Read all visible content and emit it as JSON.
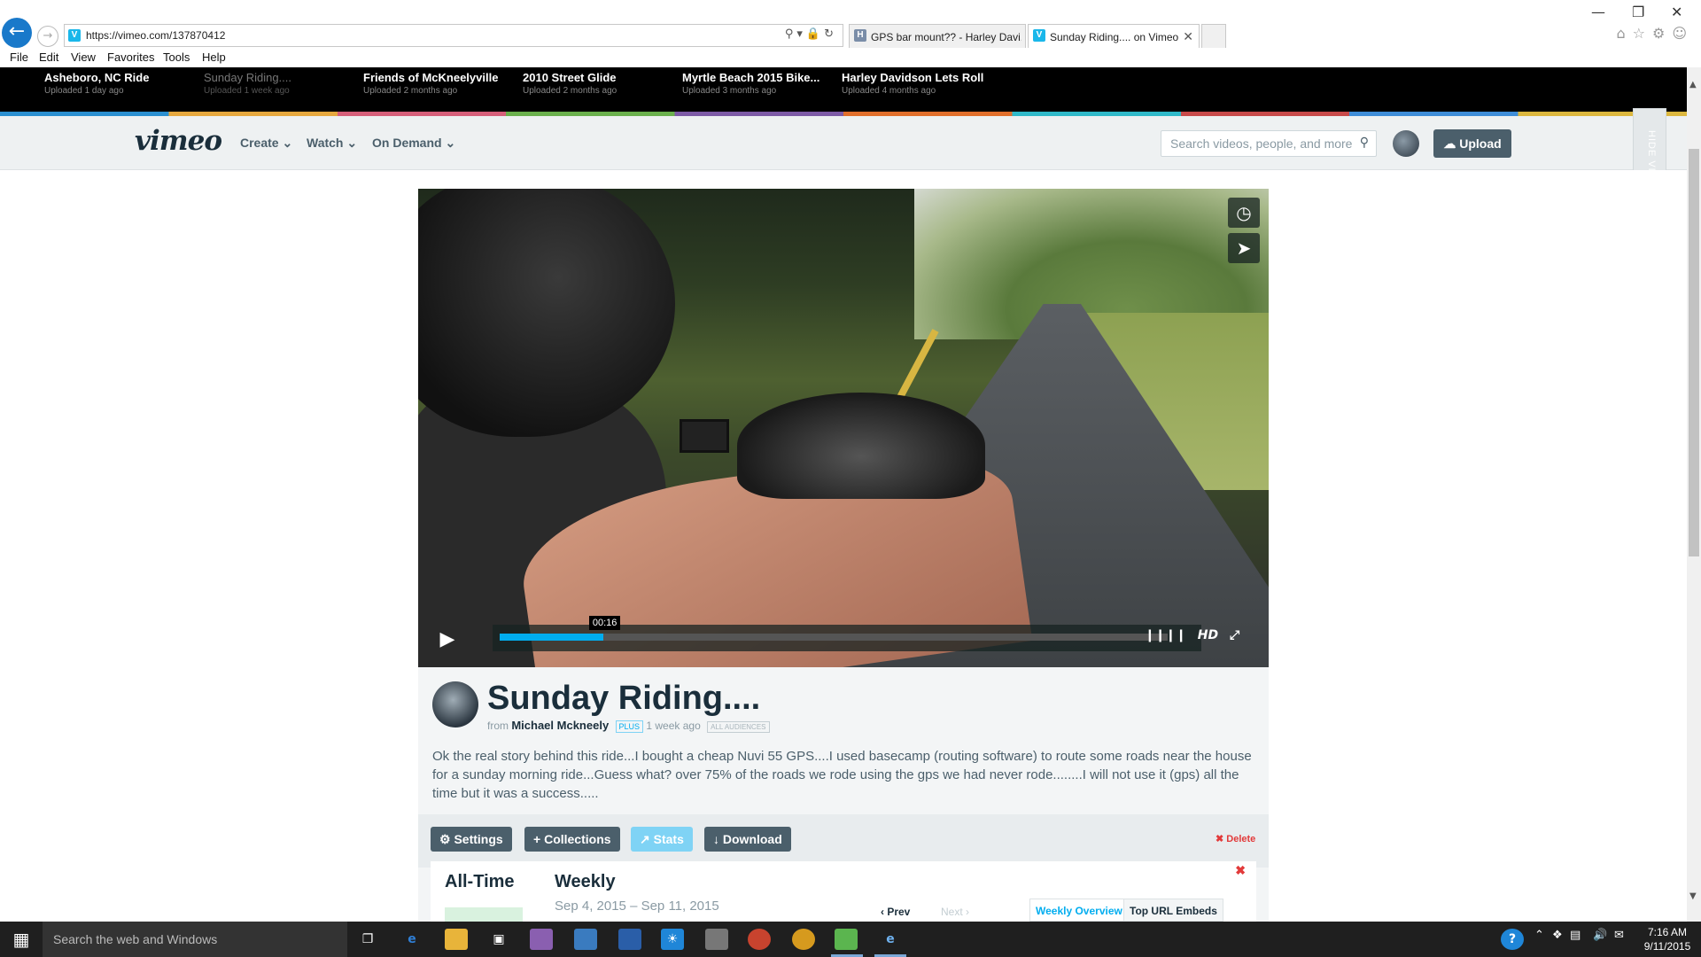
{
  "browser": {
    "url": "https://vimeo.com/137870412",
    "tabs": [
      {
        "title": "GPS bar mount?? - Harley Davi...",
        "active": false
      },
      {
        "title": "Sunday Riding.... on Vimeo",
        "active": true
      }
    ],
    "menu": [
      "File",
      "Edit",
      "View",
      "Favorites",
      "Tools",
      "Help"
    ]
  },
  "recent_videos": [
    {
      "title": "Asheboro, NC Ride",
      "uploaded": "Uploaded 1 day ago",
      "current": false
    },
    {
      "title": "Sunday Riding....",
      "uploaded": "Uploaded 1 week ago",
      "current": true
    },
    {
      "title": "Friends of McKneelyville",
      "uploaded": "Uploaded 2 months ago",
      "current": false
    },
    {
      "title": "2010 Street Glide",
      "uploaded": "Uploaded 2 months ago",
      "current": false
    },
    {
      "title": "Myrtle Beach 2015 Bike...",
      "uploaded": "Uploaded 3 months ago",
      "current": false
    },
    {
      "title": "Harley Davidson Lets Roll",
      "uploaded": "Uploaded 4 months ago",
      "current": false
    }
  ],
  "header": {
    "logo": "vimeo",
    "nav": [
      "Create",
      "Watch",
      "On Demand"
    ],
    "search_placeholder": "Search videos, people, and more",
    "upload_label": "Upload",
    "hide_videos_label": "HIDE VIDEOS"
  },
  "player": {
    "current_time": "00:16",
    "progress_fraction": 0.155,
    "hd_label": "HD"
  },
  "video": {
    "title": "Sunday Riding....",
    "from_label": "from",
    "author": "Michael Mckneely",
    "plus_badge": "PLUS",
    "age": "1 week ago",
    "audience_badge": "ALL AUDIENCES",
    "description": "Ok the real story behind this ride...I bought a cheap Nuvi 55 GPS....I used basecamp (routing software) to route some roads near the house for a sunday morning ride...Guess what? over 75% of the roads we rode using the gps we had never rode........I will not use it (gps) all the time but it was a success....."
  },
  "actions": {
    "settings": "Settings",
    "collections": "Collections",
    "stats": "Stats",
    "download": "Download",
    "delete": "Delete"
  },
  "stats": {
    "alltime_label": "All-Time",
    "weekly_label": "Weekly",
    "date_range": "Sep 4, 2015 – Sep 11, 2015",
    "prev": "‹ Prev",
    "next": "Next ›",
    "tabs": [
      "Weekly Overview",
      "Top URL Embeds"
    ]
  },
  "taskbar": {
    "search_placeholder": "Search the web and Windows",
    "time": "7:16 AM",
    "date": "9/11/2015"
  }
}
